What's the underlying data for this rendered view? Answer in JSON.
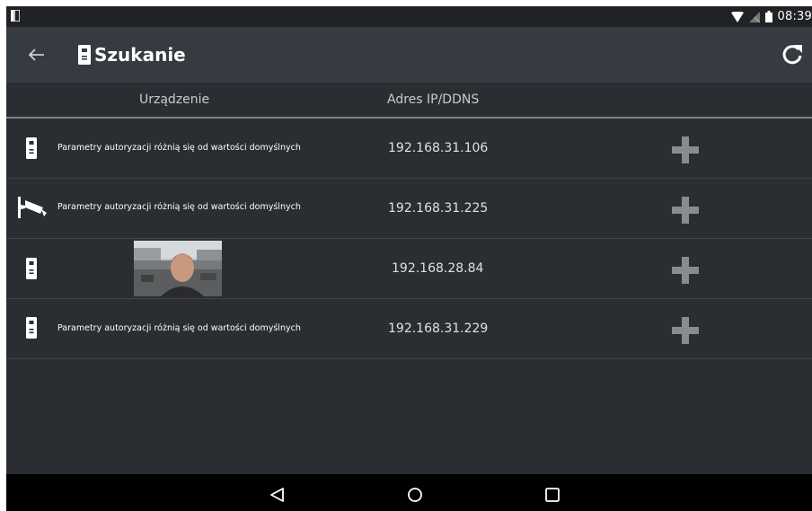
{
  "status_bar": {
    "time": "08:39"
  },
  "toolbar": {
    "title": "Szukanie"
  },
  "table": {
    "columns": [
      "Urządzenie",
      "Adres IP/DDNS"
    ],
    "rows": [
      {
        "device_type": "door-station",
        "description": "Parametry autoryzacji różnią się od wartości domyślnych",
        "ip": "192.168.31.106"
      },
      {
        "device_type": "camera",
        "description": "Parametry autoryzacji różnią się od wartości domyślnych",
        "ip": "192.168.31.225"
      },
      {
        "device_type": "door-station",
        "description": "",
        "ip": "192.168.28.84"
      },
      {
        "device_type": "door-station",
        "description": "Parametry autoryzacji różnią się od wartości domyślnych",
        "ip": "192.168.31.229"
      }
    ]
  },
  "icons": {
    "back": "arrow-back-icon",
    "title": "door-station-icon",
    "refresh": "refresh-icon",
    "add": "add-icon",
    "camera": "camera-icon",
    "nav_back": "triangle-back-icon",
    "nav_home": "circle-home-icon",
    "nav_recent": "square-recent-icon"
  },
  "colors": {
    "background": "#2a2d32",
    "toolbar": "#363a41",
    "status_bar": "#202226",
    "add_icon": "#8a8b8d",
    "nav_bar": "#000000"
  }
}
